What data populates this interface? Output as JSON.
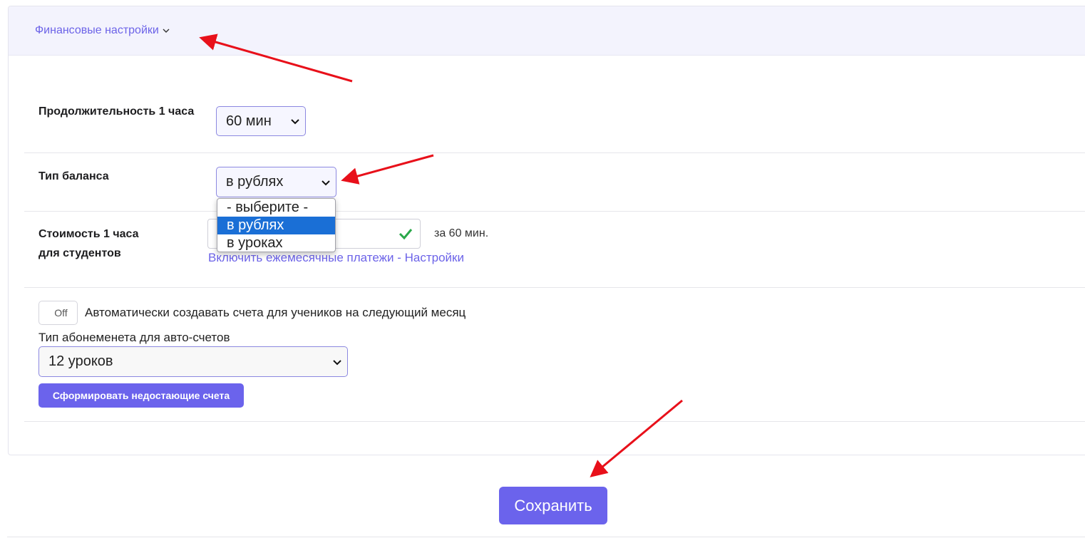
{
  "header": {
    "title": "Финансовые настройки"
  },
  "duration": {
    "label": "Продолжительность 1 часа",
    "selected": "60 мин"
  },
  "balance": {
    "label": "Тип баланса",
    "selected": "в рублях",
    "options": [
      "- выберите -",
      "в рублях",
      "в уроках"
    ],
    "highlighted_option": "в рублях"
  },
  "cost": {
    "label": "Стоимость 1 часа для студентов",
    "unit": "за 60 мин.",
    "monthly_link": "Включить ежемесячные платежи - Настройки"
  },
  "auto_invoice": {
    "toggle_label": "Off",
    "description": "Автоматически создавать счета для учеников на следующий месяц",
    "subscription_label": "Тип абонеменета для авто-счетов",
    "subscription_selected": "12 уроков",
    "generate_button": "Сформировать недостающие счета"
  },
  "footer": {
    "save_label": "Сохранить"
  },
  "colors": {
    "accent": "#6b63ec",
    "link": "#6c63e8",
    "annotation_arrow": "#e8101a",
    "check": "#2aa84a"
  }
}
